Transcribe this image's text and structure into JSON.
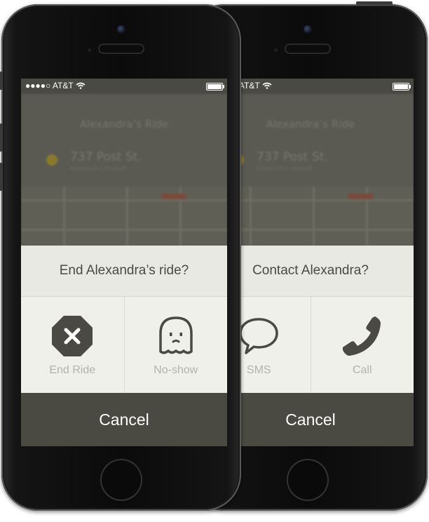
{
  "status_bar": {
    "carrier": "AT&T"
  },
  "background": {
    "ride_title": "Alexandra’s Ride",
    "address": "737 Post St.",
    "address_sub": "Alexandra dropoff"
  },
  "left_screen": {
    "prompt": "End Alexandra’s ride?",
    "actions": [
      {
        "label": "End Ride",
        "icon": "octagon-x-icon"
      },
      {
        "label": "No-show",
        "icon": "ghost-icon"
      }
    ],
    "cancel_label": "Cancel"
  },
  "right_screen": {
    "prompt": "Contact Alexandra?",
    "actions": [
      {
        "label": "SMS",
        "icon": "speech-bubble-icon"
      },
      {
        "label": "Call",
        "icon": "phone-icon"
      }
    ],
    "cancel_label": "Cancel"
  },
  "colors": {
    "sheet_background": "#f0f0ea",
    "icon_dark": "#4a4a43",
    "label_gray": "#b3b3ab",
    "cancel_bar": "#4a4a43"
  }
}
